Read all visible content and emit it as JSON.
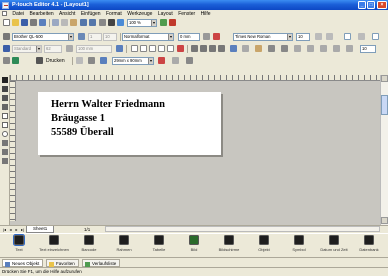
{
  "window": {
    "title": "P-touch Editor 4.1 - [Layout1]",
    "minimize_glyph": "_",
    "maximize_glyph": "□",
    "close_glyph": "×"
  },
  "menu": [
    "Datei",
    "Bearbeiten",
    "Ansicht",
    "Einfügen",
    "Format",
    "Werkzeuge",
    "Layout",
    "Fenster",
    "Hilfe"
  ],
  "toolbar1": {
    "zoom": "100 %"
  },
  "toolbar2": {
    "printer": "Brother QL-500",
    "layout_style": "Normalformat",
    "font": "Times New Roman",
    "size_1": "1",
    "size_2": "10",
    "length": "0 mm",
    "font_size": "10"
  },
  "toolbar3": {
    "paper": "Standard",
    "width": "62",
    "height": "100 mm",
    "print_label": "Drucken",
    "tape": "29mm x 90mm",
    "font_size": "10"
  },
  "label": {
    "lines": [
      "Herrn Walter Friedmann",
      "Bräugasse 1",
      "55589 Überall"
    ]
  },
  "sheet_tab": "Sheet1",
  "page_indicator": "1/1",
  "object_bar": [
    {
      "icon": "text-icon",
      "label": "Text"
    },
    {
      "icon": "text-template-icon",
      "label": "Text einzeichnen"
    },
    {
      "icon": "barcode-icon",
      "label": "Barcode"
    },
    {
      "icon": "frame-icon",
      "label": "Rahmen"
    },
    {
      "icon": "table-icon",
      "label": "Tabelle"
    },
    {
      "icon": "picture-icon",
      "label": "Bild"
    },
    {
      "icon": "clipart-icon",
      "label": "Bildschirme"
    },
    {
      "icon": "object-icon",
      "label": "Objekt"
    },
    {
      "icon": "symbol-icon",
      "label": "Symbol"
    },
    {
      "icon": "date-time-icon",
      "label": "Datum und Zeit"
    },
    {
      "icon": "database-icon",
      "label": "Datenbank"
    }
  ],
  "panes": [
    "Neues Objekt",
    "Favoriten",
    "Verlaufsliste"
  ],
  "status": "Drücken Sie F1, um die Hilfe aufzurufen"
}
